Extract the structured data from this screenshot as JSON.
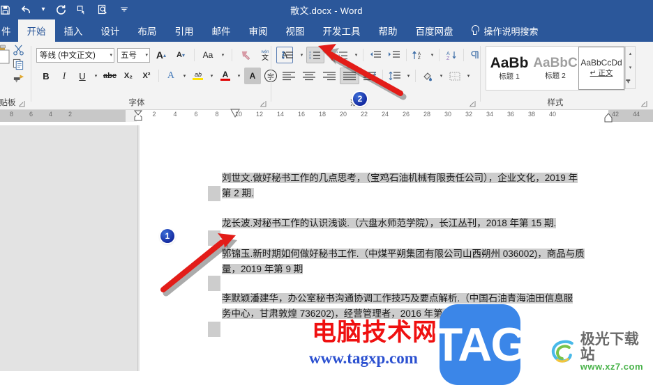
{
  "titlebar": {
    "document_title": "散文.docx  -  Word",
    "quick_access": [
      {
        "name": "save-icon",
        "glyph": "ὋE"
      },
      {
        "name": "undo-icon",
        "glyph": "↶"
      },
      {
        "name": "undo-dropdown-icon",
        "glyph": "⌄"
      },
      {
        "name": "redo-icon",
        "glyph": "↻"
      },
      {
        "name": "touch-mode-icon",
        "glyph": "❑"
      },
      {
        "name": "print-preview-icon",
        "glyph": "⌗"
      },
      {
        "name": "customize-qat-icon",
        "glyph": "⌄"
      }
    ]
  },
  "tabs": [
    {
      "id": "file",
      "label": "件",
      "active": false
    },
    {
      "id": "home",
      "label": "开始",
      "active": true
    },
    {
      "id": "insert",
      "label": "插入",
      "active": false
    },
    {
      "id": "design",
      "label": "设计",
      "active": false
    },
    {
      "id": "layout",
      "label": "布局",
      "active": false
    },
    {
      "id": "references",
      "label": "引用",
      "active": false
    },
    {
      "id": "mailings",
      "label": "邮件",
      "active": false
    },
    {
      "id": "review",
      "label": "审阅",
      "active": false
    },
    {
      "id": "view",
      "label": "视图",
      "active": false
    },
    {
      "id": "developer",
      "label": "开发工具",
      "active": false
    },
    {
      "id": "help",
      "label": "帮助",
      "active": false
    },
    {
      "id": "baidu-netdisk",
      "label": "百度网盘",
      "active": false
    }
  ],
  "tell_me": {
    "label": "操作说明搜索"
  },
  "ribbon": {
    "groups": [
      {
        "id": "clipboard",
        "label": "贴板"
      },
      {
        "id": "font",
        "label": "字体"
      },
      {
        "id": "paragraph",
        "label": "落"
      },
      {
        "id": "styles",
        "label": "样式"
      }
    ],
    "font": {
      "font_name": "等线 (中文正文)",
      "font_size": "五号",
      "grow_font": "A",
      "shrink_font": "A",
      "change_case": "Aa",
      "clear_formatting": "清除格式",
      "phonetic_guide": "拼音指南",
      "character_border": "A",
      "bold": "B",
      "italic": "I",
      "underline": "U",
      "strikethrough": "abc",
      "subscript": "X₂",
      "superscript": "X²",
      "text_effects": "A",
      "text_highlight": "ab",
      "font_color": "A",
      "character_shading": "A",
      "enclose_characters": "字"
    },
    "paragraph": {
      "bullets": "bullet-list",
      "numbering": "numbered-list",
      "multilevel": "multilevel-list",
      "decrease_indent": "decrease-indent",
      "increase_indent": "increase-indent",
      "sort": "sort-az",
      "show_marks": "show-formatting-marks",
      "align_left": "align-left",
      "align_center": "align-center",
      "align_right": "align-right",
      "justify": "justify",
      "distribute": "distribute",
      "line_spacing": "line-spacing",
      "shading": "shading",
      "borders": "borders"
    },
    "styles": {
      "items": [
        {
          "preview": "AaBb",
          "name": "标题 1",
          "selected": false
        },
        {
          "preview": "AaBbC",
          "name": "标题 2",
          "selected": false
        },
        {
          "preview": "AaBbCcDd",
          "name": "正文",
          "selected": true,
          "pilcrow": "↵"
        }
      ]
    }
  },
  "ruler": {
    "left_ticks": [
      "8",
      "6",
      "4",
      "2"
    ],
    "ticks": [
      "2",
      "4",
      "6",
      "8",
      "10",
      "12",
      "14",
      "16",
      "18",
      "20",
      "22",
      "24",
      "26",
      "28",
      "30",
      "32",
      "34",
      "36",
      "38",
      "40",
      "42",
      "44"
    ],
    "right_margin_at": "40"
  },
  "document": {
    "paragraphs": [
      {
        "id": "ref-1",
        "lines": [
          "刘世文.做好秘书工作的几点思考，（宝鸡石油机械有限责任公司），企业文化，2019 年",
          "第 2 期."
        ]
      },
      {
        "id": "ref-2",
        "lines": [
          "龙长波.对秘书工作的认识浅谈.（六盘水师范学院），长江丛刊，2018 年第 15 期."
        ]
      },
      {
        "id": "ref-3",
        "lines": [
          "郭锦玉.新时期如何做好秘书工作.（中煤平朔集团有限公司山西朔州 036002)，商品与质",
          "量，2019 年第 9 期"
        ]
      },
      {
        "id": "ref-4",
        "lines": [
          "李默颖潘建华，办公室秘书沟通协调工作技巧及要点解析.（中国石油青海油田信息服",
          "务中心，甘肃敦煌 736202)，经营管理者，2016 年第 16 期"
        ]
      }
    ]
  },
  "annotations": {
    "badges": [
      {
        "id": "badge-1",
        "label": "1"
      },
      {
        "id": "badge-2",
        "label": "2"
      }
    ],
    "arrows": [
      {
        "id": "arrow-to-document",
        "color": "#e31c18"
      },
      {
        "id": "arrow-to-numbering-button",
        "color": "#e31c18"
      }
    ]
  },
  "watermarks": {
    "site_name_cn": "电脑技术网",
    "site_url": "www.tagxp.com",
    "tag_logo": "TAG",
    "downloader_name": "极光下载站",
    "downloader_url": "www.xz7.com"
  },
  "colors": {
    "ribbon_blue": "#2b579a",
    "ribbon_bg": "#f3f3f3",
    "canvas_gray": "#e3e3e3",
    "selection_gray": "#cdcdcd",
    "arrow_red": "#e31c18",
    "badge_blue": "#12279e",
    "tag_blue": "#3b86e8"
  }
}
